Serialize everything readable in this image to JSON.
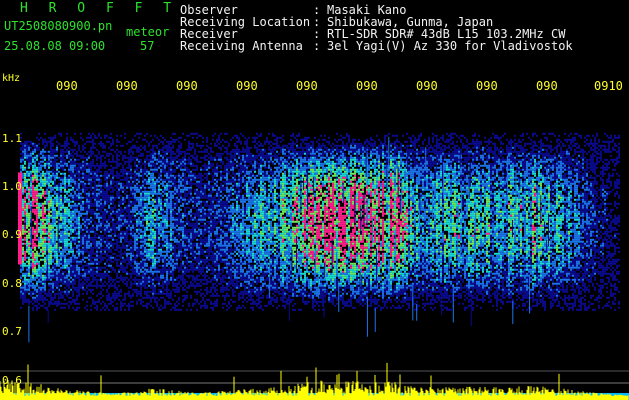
{
  "header": {
    "title": "H R O F F T",
    "file": "UT2508080900.pn",
    "meteor_label": "meteor",
    "date": "25.08.08 09:00",
    "count": "57"
  },
  "info": [
    {
      "label": "Observer",
      "value": "Masaki Kano"
    },
    {
      "label": "Receiving Location",
      "value": "Shibukawa, Gunma, Japan"
    },
    {
      "label": "Receiver",
      "value": "RTL-SDR SDR# 43dB L15 103.2MHz CW"
    },
    {
      "label": "Receiving Antenna",
      "value": "3el Yagi(V) Az 330 for Vladivostok"
    }
  ],
  "colors": {
    "background": "#000000",
    "low": "#0a0a8c",
    "mid": "#1a74e8",
    "cyan": "#18d8d0",
    "green": "#6ee85a",
    "hot": "#ff1e8c",
    "trace": "#ffff00",
    "baseline": "#00b8ff",
    "text_green": "#2de22d",
    "text_white": "#f2f2f2",
    "text_yellow": "#ffff2a"
  },
  "chart_data": {
    "type": "heatmap",
    "title": "",
    "xlabel": "",
    "ylabel": "kHz",
    "x_tick_labels": [
      "090",
      "090",
      "090",
      "090",
      "090",
      "090",
      "090",
      "090",
      "090",
      "0910"
    ],
    "y_ticks": [
      {
        "label": "1.1",
        "value": 1.1
      },
      {
        "label": "1.0",
        "value": 1.0
      },
      {
        "label": "0.9",
        "value": 0.9
      },
      {
        "label": "0.8",
        "value": 0.8
      },
      {
        "label": "0.7",
        "value": 0.7
      },
      {
        "label": "0.6",
        "value": 0.6
      }
    ],
    "xlim": [
      0,
      10
    ],
    "ylim": [
      0.56,
      1.19
    ],
    "grid": false,
    "band_center_khz": 0.93,
    "band_halfwidth_khz": 0.12,
    "activity_minutes": [
      {
        "minute": 0.0,
        "level": 1.0
      },
      {
        "minute": 0.6,
        "level": 0.55
      },
      {
        "minute": 1.0,
        "level": 0.35
      },
      {
        "minute": 1.6,
        "level": 0.15
      },
      {
        "minute": 2.2,
        "level": 0.5
      },
      {
        "minute": 3.0,
        "level": 0.2
      },
      {
        "minute": 4.1,
        "level": 0.55
      },
      {
        "minute": 4.6,
        "level": 0.75
      },
      {
        "minute": 5.0,
        "level": 1.0
      },
      {
        "minute": 5.7,
        "level": 1.0
      },
      {
        "minute": 6.2,
        "level": 0.95
      },
      {
        "minute": 6.6,
        "level": 0.55
      },
      {
        "minute": 7.2,
        "level": 0.6
      },
      {
        "minute": 8.0,
        "level": 0.55
      },
      {
        "minute": 8.6,
        "level": 0.7
      },
      {
        "minute": 9.1,
        "level": 0.45
      },
      {
        "minute": 9.6,
        "level": 0.2
      },
      {
        "minute": 10.0,
        "level": 0.1
      }
    ]
  }
}
